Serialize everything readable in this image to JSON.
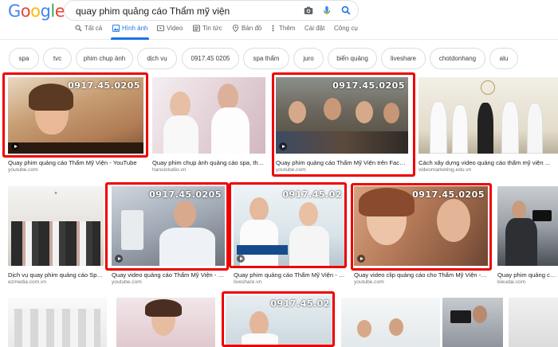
{
  "logo": {
    "letters": [
      "G",
      "o",
      "o",
      "g",
      "l",
      "e"
    ],
    "colors": [
      "#4285f4",
      "#ea4335",
      "#fbbc05",
      "#4285f4",
      "#34a853",
      "#ea4335"
    ]
  },
  "search": {
    "query": "quay phim quảng cáo Thẩm mỹ viện"
  },
  "tabs": [
    {
      "label": "Tất cả",
      "icon": "search-icon"
    },
    {
      "label": "Hình ảnh",
      "icon": "image-icon",
      "active": true
    },
    {
      "label": "Video",
      "icon": "video-icon"
    },
    {
      "label": "Tin tức",
      "icon": "news-icon"
    },
    {
      "label": "Bản đồ",
      "icon": "map-pin-icon"
    },
    {
      "label": "Thêm",
      "icon": "more-icon"
    },
    {
      "label": "Cài đặt"
    },
    {
      "label": "Công cụ"
    }
  ],
  "chips": [
    "spa",
    "tvc",
    "phim chụp ảnh",
    "dịch vụ",
    "0917.45 0205",
    "spa thẩm",
    "juro",
    "biển quảng",
    "liveshare",
    "chotdonhang",
    "alu"
  ],
  "phone_overlay": "0917.45.0205",
  "phone_overlay_short": "0917.45.02",
  "results": {
    "r1": [
      {
        "title": "Quay phim quảng cáo Thẩm Mỹ Viện - YouTube",
        "source": "youtube.com"
      },
      {
        "title": "Quay phim chụp ảnh quảng cáo spa, thẩm ...",
        "source": "hanoistudio.vn"
      },
      {
        "title": "Quay phim quảng cáo Thẩm Mỹ Viện trên Faceboo...",
        "source": "youtube.com"
      },
      {
        "title": "Cách xây dựng video quảng cáo thẩm mỹ viện ...",
        "source": "videomarketing.edu.vn"
      }
    ],
    "r2": [
      {
        "title": "Dịch vụ quay phim quảng cáo Spa...",
        "source": "ezmedia.com.vn"
      },
      {
        "title": "Quay video quảng cáo Thẩm Mỹ Viện - nh...",
        "source": "youtube.com"
      },
      {
        "title": "Quay phim quảng cáo Thẩm Mỹ Viện - nh...",
        "source": "liveshare.vn"
      },
      {
        "title": "Quay video clip quảng cáo cho Thẩm Mỹ Viện - nh...",
        "source": "youtube.com"
      },
      {
        "title": "Quay phim quảng cáo Spa LA...",
        "source": "kieudai.com"
      }
    ]
  },
  "colors": {
    "accent": "#1a73e8",
    "highlight": "#ee0000"
  }
}
